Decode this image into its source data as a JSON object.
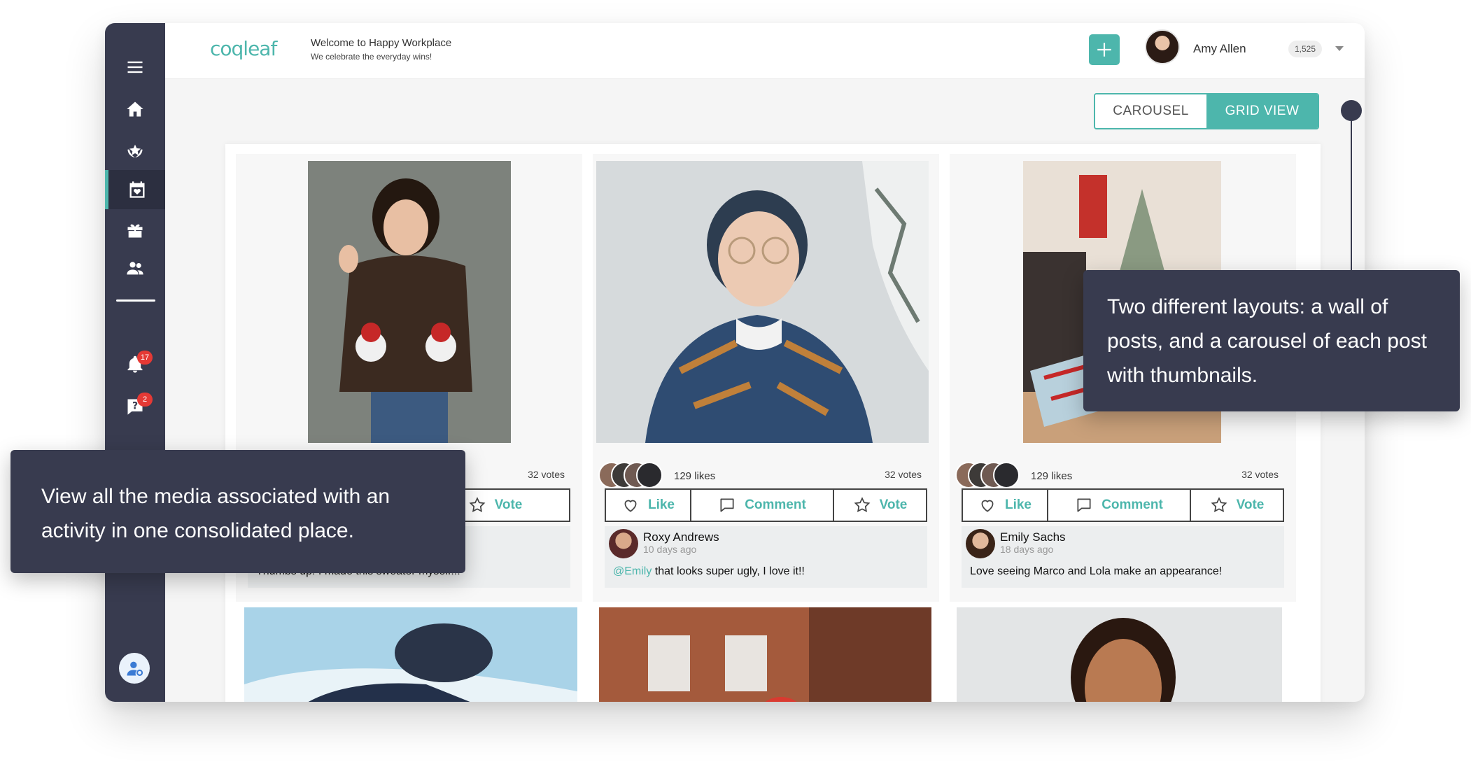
{
  "header": {
    "logo": "coqleaf",
    "welcome_title": "Welcome to Happy Workplace",
    "welcome_subtitle": "We celebrate the everyday wins!",
    "user_name": "Amy Allen",
    "points": "1,525"
  },
  "sidebar": {
    "items": [
      {
        "icon": "menu-icon"
      },
      {
        "icon": "home-icon"
      },
      {
        "icon": "award-icon"
      },
      {
        "icon": "calendar-heart-icon",
        "active": true
      },
      {
        "icon": "gift-icon"
      },
      {
        "icon": "people-icon"
      },
      {
        "icon": "bell-icon",
        "badge": "17"
      },
      {
        "icon": "help-icon",
        "badge": "2"
      }
    ]
  },
  "view_toggle": {
    "carousel": "CAROUSEL",
    "grid": "GRID VIEW",
    "selected": "GRID VIEW"
  },
  "posts": [
    {
      "votes": "32 votes",
      "actions": {
        "vote": "Vote"
      },
      "comment_text": "Thumbs up! I made this sweater myself!!!"
    },
    {
      "likes": "129 likes",
      "votes": "32 votes",
      "actions": {
        "like": "Like",
        "comment": "Comment",
        "vote": "Vote"
      },
      "commenter": "Roxy Andrews",
      "comment_time": "10 days ago",
      "mention": "@Emily",
      "comment_text": " that looks super ugly, I love it!!"
    },
    {
      "likes": "129 likes",
      "votes": "32 votes",
      "actions": {
        "like": "Like",
        "comment": "Comment",
        "vote": "Vote"
      },
      "commenter": "Emily Sachs",
      "comment_time": "18 days ago",
      "comment_text": "Love seeing Marco and Lola make an appearance!"
    }
  ],
  "callouts": {
    "top_right": "Two different layouts: a wall of posts, and a carousel of each post with thumbnails.",
    "left": "View all the media associated with an activity in one consolidated place."
  },
  "colors": {
    "accent": "#4db6ac",
    "sidebar": "#383b4f",
    "badge": "#e53935"
  }
}
